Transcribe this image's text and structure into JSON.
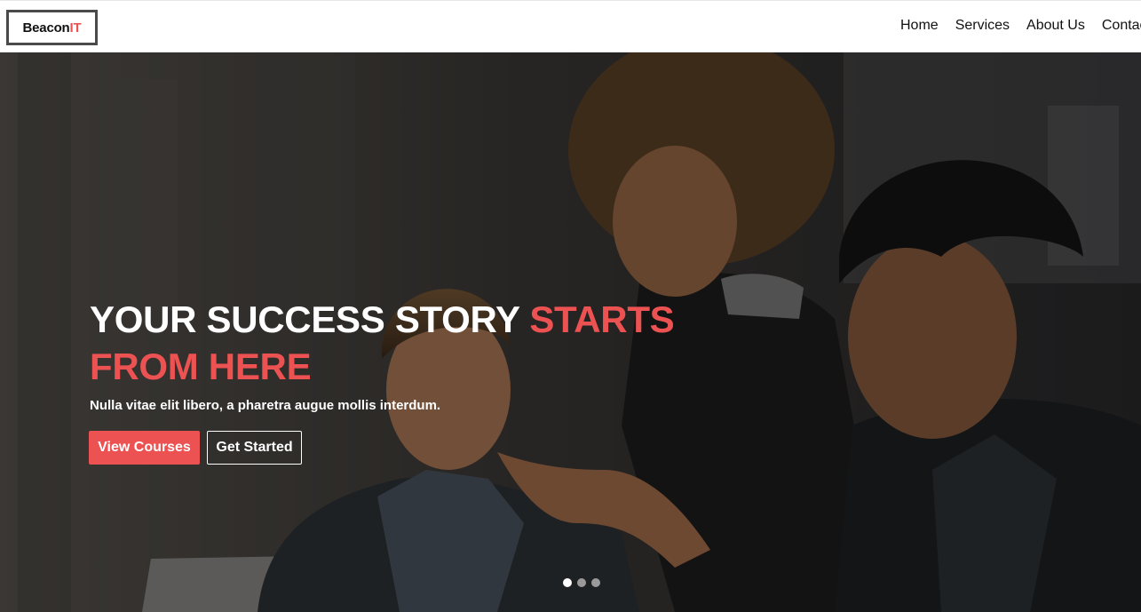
{
  "brand": {
    "name_main": "Beacon",
    "name_accent": "IT"
  },
  "nav": {
    "items": [
      {
        "label": "Home"
      },
      {
        "label": "Services"
      },
      {
        "label": "About Us"
      },
      {
        "label": "Contact"
      }
    ]
  },
  "hero": {
    "headline_main": "YOUR SUCCESS STORY ",
    "headline_accent": "STARTS FROM HERE",
    "subtitle": "Nulla vitae elit libero, a pharetra augue mollis interdum.",
    "primary_button": "View Courses",
    "secondary_button": "Get Started",
    "slides_count": 3,
    "active_slide": 1
  },
  "colors": {
    "accent": "#ec5252",
    "text_dark": "#111111",
    "white": "#ffffff"
  }
}
